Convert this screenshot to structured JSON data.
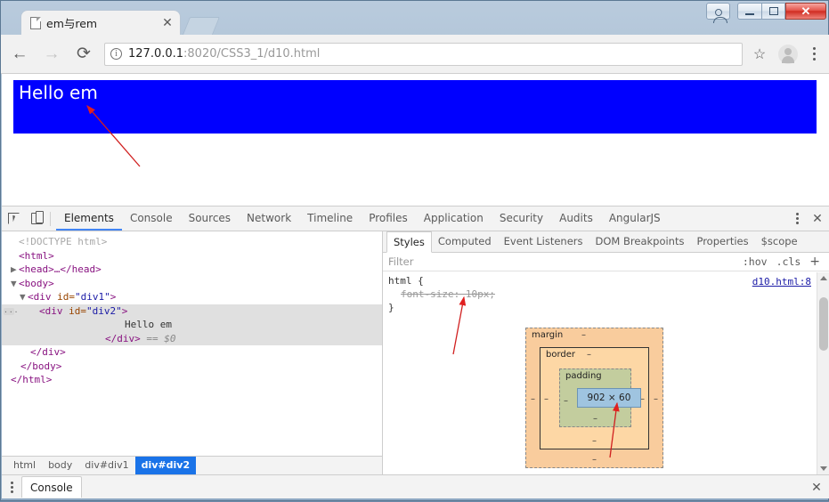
{
  "window": {
    "controls": {
      "person_label": "person-icon",
      "minimize_label": "minimize",
      "maximize_label": "maximize",
      "close_label": "✕"
    }
  },
  "browser": {
    "tab": {
      "title": "em与rem",
      "close_label": "✕"
    },
    "toolbar": {
      "back_label": "←",
      "forward_label": "→",
      "reload_label": "⟳",
      "info_label": "i",
      "url_host": "127.0.0.1",
      "url_path": ":8020/CSS3_1/d10.html",
      "star_label": "☆",
      "menu_label": "menu"
    }
  },
  "page": {
    "div2_text": "Hello em",
    "div2_bg": "#0000ff",
    "div2_color": "#ffffff"
  },
  "devtools": {
    "tabs": [
      {
        "label": "Elements",
        "active": true
      },
      {
        "label": "Console",
        "active": false
      },
      {
        "label": "Sources",
        "active": false
      },
      {
        "label": "Network",
        "active": false
      },
      {
        "label": "Timeline",
        "active": false
      },
      {
        "label": "Profiles",
        "active": false
      },
      {
        "label": "Application",
        "active": false
      },
      {
        "label": "Security",
        "active": false
      },
      {
        "label": "Audits",
        "active": false
      },
      {
        "label": "AngularJS",
        "active": false
      }
    ],
    "close_label": "✕",
    "dom": {
      "line_doctype": "<!DOCTYPE html>",
      "line_html_open": "<html>",
      "line_head": "<head>…</head>",
      "line_body_open": "<body>",
      "line_div1_open_tag": "div",
      "line_div1_attr": "id",
      "line_div1_val": "\"div1\"",
      "line_div2_open_tag": "div",
      "line_div2_attr": "id",
      "line_div2_val": "\"div2\"",
      "line_text": "Hello em",
      "line_div2_close": "</div>",
      "line_eq": "== $0",
      "line_div1_close": "</div>",
      "line_body_close": "</body>",
      "line_html_close": "</html>",
      "ellipsis_badge": "..."
    },
    "breadcrumb": [
      {
        "label": "html",
        "active": false
      },
      {
        "label": "body",
        "active": false
      },
      {
        "label": "div#div1",
        "active": false
      },
      {
        "label": "div#div2",
        "active": true
      }
    ],
    "styles": {
      "tabs": [
        {
          "label": "Styles",
          "active": true
        },
        {
          "label": "Computed",
          "active": false
        },
        {
          "label": "Event Listeners",
          "active": false
        },
        {
          "label": "DOM Breakpoints",
          "active": false
        },
        {
          "label": "Properties",
          "active": false
        },
        {
          "label": "$scope",
          "active": false
        }
      ],
      "filter_placeholder": "Filter",
      "hov_label": ":hov",
      "cls_label": ".cls",
      "add_label": "+",
      "rule_selector": "html {",
      "rule_property": "font-size: 10px;",
      "rule_close": "}",
      "rule_source": "d10.html:8"
    },
    "box_model": {
      "margin_label": "margin",
      "border_label": "border",
      "padding_label": "padding",
      "content_size": "902 × 60",
      "dash": "–"
    }
  },
  "drawer": {
    "tab_label": "Console",
    "close_label": "✕"
  }
}
